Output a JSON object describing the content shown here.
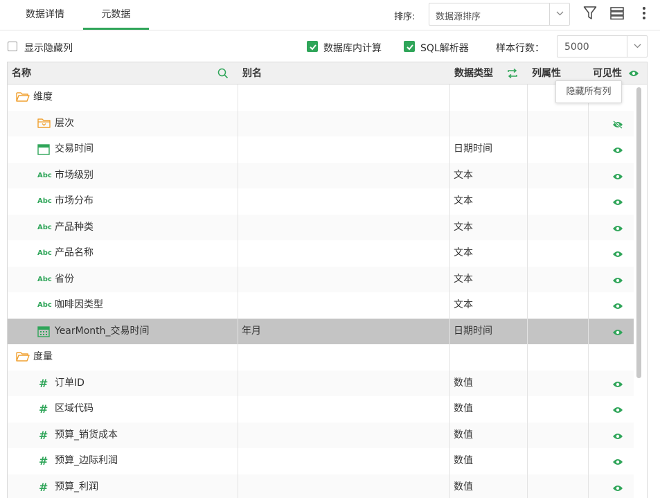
{
  "tabs": [
    {
      "label": "数据详情",
      "active": false
    },
    {
      "label": "元数据",
      "active": true
    }
  ],
  "toolbar": {
    "sort_label": "排序:",
    "sort_value": "数据源排序",
    "filter_icon": "filter-icon",
    "columns_icon": "list-layout-icon",
    "more_icon": "more-vertical-icon"
  },
  "options": {
    "show_hidden": {
      "label": "显示隐藏列",
      "checked": false
    },
    "db_compute": {
      "label": "数据库内计算",
      "checked": true
    },
    "sql_parser": {
      "label": "SQL解析器",
      "checked": true
    },
    "sample_label": "样本行数：",
    "sample_value": "5000"
  },
  "table": {
    "headers": {
      "name": "名称",
      "alias": "别名",
      "type": "数据类型",
      "props": "列属性",
      "visible": "可见性"
    },
    "rows": [
      {
        "icon": "folder-icon",
        "name": "维度",
        "alias": "",
        "type": "",
        "eye": ""
      },
      {
        "icon": "hierarchy-folder-icon",
        "name": "层次",
        "alias": "",
        "type": "",
        "eye": "eye-slash-icon"
      },
      {
        "icon": "calendar-icon",
        "name": "交易时间",
        "alias": "",
        "type": "日期时间",
        "eye": "eye-icon"
      },
      {
        "icon": "text-type-icon",
        "name": "市场级别",
        "alias": "",
        "type": "文本",
        "eye": "eye-icon"
      },
      {
        "icon": "text-type-icon",
        "name": "市场分布",
        "alias": "",
        "type": "文本",
        "eye": "eye-icon"
      },
      {
        "icon": "text-type-icon",
        "name": "产品种类",
        "alias": "",
        "type": "文本",
        "eye": "eye-icon"
      },
      {
        "icon": "text-type-icon",
        "name": "产品名称",
        "alias": "",
        "type": "文本",
        "eye": "eye-icon"
      },
      {
        "icon": "text-type-icon",
        "name": "省份",
        "alias": "",
        "type": "文本",
        "eye": "eye-icon"
      },
      {
        "icon": "text-type-icon",
        "name": "咖啡因类型",
        "alias": "",
        "type": "文本",
        "eye": "eye-icon"
      },
      {
        "icon": "date-field-icon",
        "name": "YearMonth_交易时间",
        "alias": "年月",
        "type": "日期时间",
        "eye": "eye-icon",
        "selected": true
      },
      {
        "icon": "folder-icon",
        "name": "度量",
        "alias": "",
        "type": "",
        "eye": ""
      },
      {
        "icon": "number-type-icon",
        "name": "订单ID",
        "alias": "",
        "type": "数值",
        "eye": "eye-icon"
      },
      {
        "icon": "number-type-icon",
        "name": "区域代码",
        "alias": "",
        "type": "数值",
        "eye": "eye-icon"
      },
      {
        "icon": "number-type-icon",
        "name": "预算_销货成本",
        "alias": "",
        "type": "数值",
        "eye": "eye-icon"
      },
      {
        "icon": "number-type-icon",
        "name": "预算_边际利润",
        "alias": "",
        "type": "数值",
        "eye": "eye-icon"
      },
      {
        "icon": "number-type-icon",
        "name": "预算_利润",
        "alias": "",
        "type": "数值",
        "eye": "eye-icon"
      }
    ],
    "text_icon_label": "Abc",
    "number_icon_label": "#"
  },
  "tooltip": "隐藏所有列",
  "colors": {
    "accent": "#2fa559",
    "folder": "#f0a030",
    "selected_row": "#c4c4c4"
  }
}
